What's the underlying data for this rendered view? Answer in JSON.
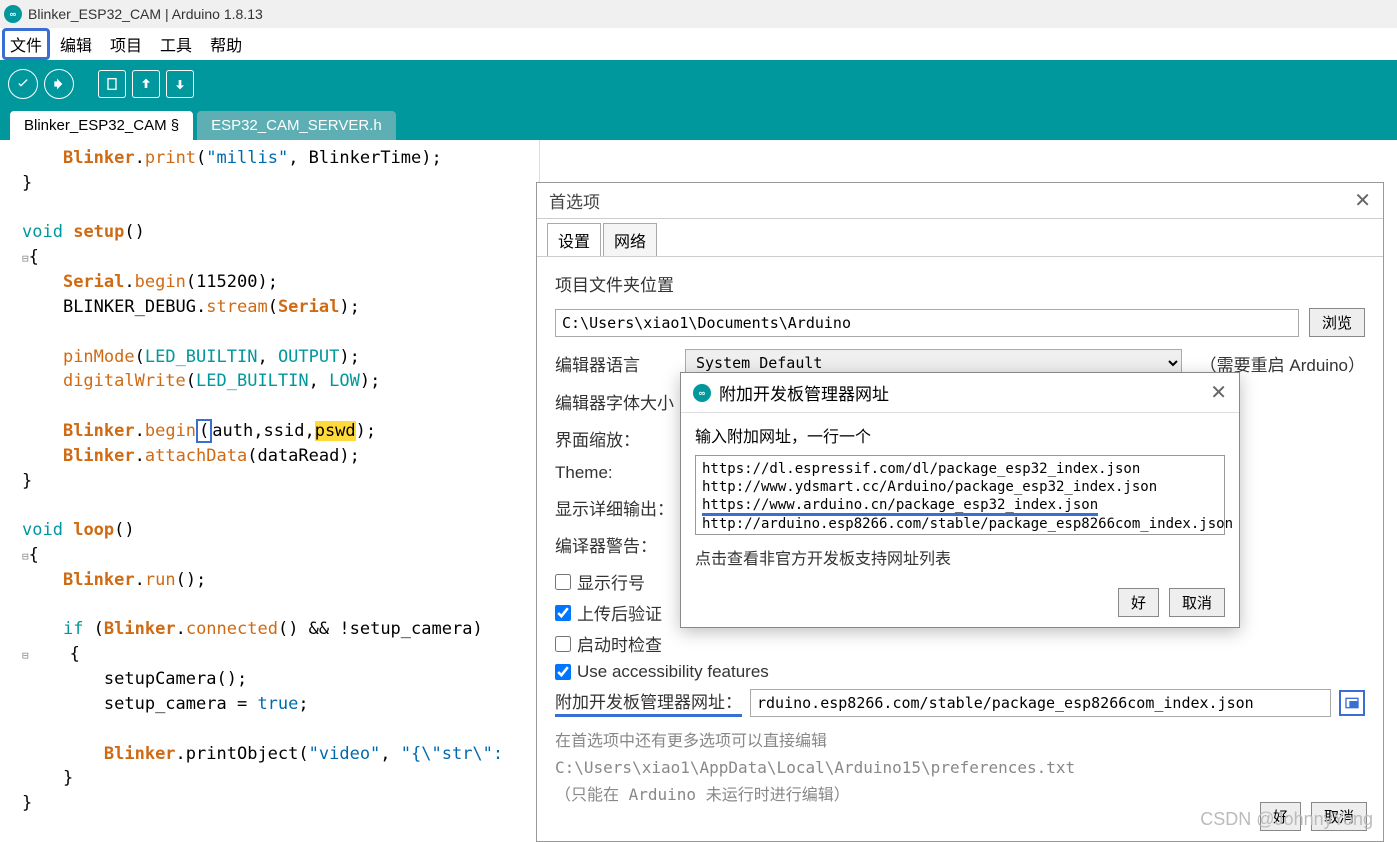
{
  "window": {
    "title": "Blinker_ESP32_CAM | Arduino 1.8.13"
  },
  "menu": {
    "file": "文件",
    "edit": "编辑",
    "project": "项目",
    "tools": "工具",
    "help": "帮助"
  },
  "tabs": {
    "main": "Blinker_ESP32_CAM §",
    "header": "ESP32_CAM_SERVER.h"
  },
  "pref": {
    "title": "首选项",
    "tab_settings": "设置",
    "tab_network": "网络",
    "loc_label": "项目文件夹位置",
    "loc_value": "C:\\Users\\xiao1\\Documents\\Arduino",
    "browse": "浏览",
    "lang_label": "编辑器语言",
    "lang_value": "System Default",
    "lang_note": "（需要重启 Arduino）",
    "font_label": "编辑器字体大小",
    "scale_label": "界面缩放：",
    "theme_label": "Theme:",
    "verbose_label": "显示详细输出：",
    "warn_label": "编译器警告：",
    "chk_lineno": "显示行号",
    "chk_verify": "上传后验证",
    "chk_check": "启动时检查",
    "chk_accy": "Use accessibility features",
    "url_label": "附加开发板管理器网址：",
    "url_value": "rduino.esp8266.com/stable/package_esp8266com_index.json",
    "gray1": "在首选项中还有更多选项可以直接编辑",
    "gray2": "C:\\Users\\xiao1\\AppData\\Local\\Arduino15\\preferences.txt",
    "gray3": "（只能在 Arduino 未运行时进行编辑）",
    "ok": "好",
    "cancel": "取消"
  },
  "urldlg": {
    "title": "附加开发板管理器网址",
    "prompt": "输入附加网址，一行一个",
    "l1": "https://dl.espressif.com/dl/package_esp32_index.json",
    "l2": "http://www.ydsmart.cc/Arduino/package_esp32_index.json",
    "l3": "https://www.arduino.cn/package_esp32_index.json",
    "l4": "http://arduino.esp8266.com/stable/package_esp8266com_index.json",
    "link": "点击查看非官方开发板支持网址列表",
    "ok": "好",
    "cancel": "取消"
  },
  "code": {
    "blinker": "Blinker",
    "print": "print",
    "millis_str": "\"millis\"",
    "btime": "BlinkerTime",
    "void": "void",
    "setup": "setup",
    "serial": "Serial",
    "begin": "begin",
    "baud": "115200",
    "debug": "BLINKER_DEBUG",
    "stream": "stream",
    "pinmode": "pinMode",
    "led": "LED_BUILTIN",
    "output": "OUTPUT",
    "dw": "digitalWrite",
    "low": "LOW",
    "auth": "auth",
    "ssid": "ssid",
    "pswd": "pswd",
    "attach": "attachData",
    "dataread": "dataRead",
    "loop": "loop",
    "run": "run",
    "if": "if",
    "connected": "connected",
    "setupcam_var": "setup_camera",
    "setupcam_fn": "setupCamera",
    "true": "true",
    "printobj": "printObject",
    "video_str": "\"video\"",
    "obj_str": "\"{\\\"str\\\":"
  },
  "watermark": "CSDN @JohnnyYong"
}
